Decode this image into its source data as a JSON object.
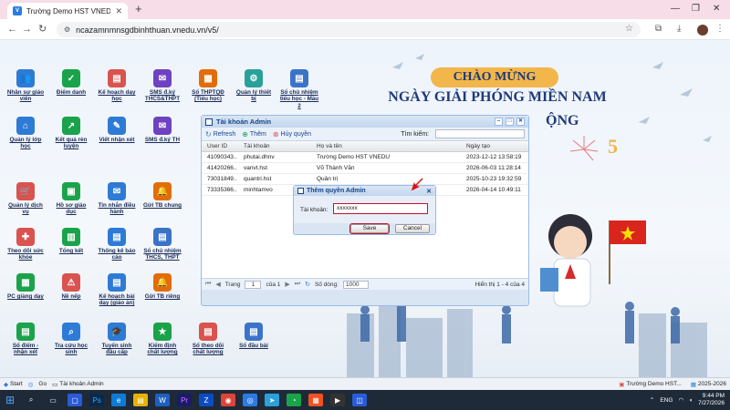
{
  "browser": {
    "tab_title": "Trường Demo HST VNEDU - Là",
    "url": "ncazamnmnsgdbinhthuan.vnedu.vn/v5/"
  },
  "desktop_icons": [
    {
      "label": "Nhân sự giáo viên",
      "color": "#2e7bd6",
      "glyph": "👥"
    },
    {
      "label": "Điểm danh",
      "color": "#1aa34a",
      "glyph": "✓"
    },
    {
      "label": "Kế hoạch dạy học",
      "color": "#d9534f",
      "glyph": "▤"
    },
    {
      "label": "SMS đ.ký THCS&THPT",
      "color": "#6f42c1",
      "glyph": "✉"
    },
    {
      "label": "Sổ THPTQĐ (Tiểu học)",
      "color": "#e36c0a",
      "glyph": "▦"
    },
    {
      "label": "Quản lý thiết bị",
      "color": "#2aa198",
      "glyph": "⚙"
    },
    {
      "label": "Sổ chủ nhiệm tiểu học - Mẫu 2",
      "color": "#3b73c8",
      "glyph": "▤"
    },
    {
      "label": "Quản lý lớp học",
      "color": "#2e7bd6",
      "glyph": "⌂"
    },
    {
      "label": "Kết quả rèn luyện",
      "color": "#1aa34a",
      "glyph": "↗"
    },
    {
      "label": "Viết nhận xét",
      "color": "#2e7bd6",
      "glyph": "✎"
    },
    {
      "label": "SMS đ.ký TH",
      "color": "#6f42c1",
      "glyph": "✉"
    },
    {
      "label": "Quản lý dịch vụ",
      "color": "#d9534f",
      "glyph": "🛒"
    },
    {
      "label": "Hồ sơ giáo dục",
      "color": "#1aa34a",
      "glyph": "▣"
    },
    {
      "label": "Tin nhắn điều hành",
      "color": "#2e7bd6",
      "glyph": "✉"
    },
    {
      "label": "Gửi TB chung",
      "color": "#e36c0a",
      "glyph": "🔔"
    },
    {
      "label": "Theo dõi sức khỏe",
      "color": "#d9534f",
      "glyph": "✚"
    },
    {
      "label": "Tổng kết",
      "color": "#1aa34a",
      "glyph": "▥"
    },
    {
      "label": "Thống kê báo cáo",
      "color": "#2e7bd6",
      "glyph": "▤"
    },
    {
      "label": "Sổ chủ nhiệm THCS, THPT",
      "color": "#3b73c8",
      "glyph": "▤"
    },
    {
      "label": "PC giảng dạy",
      "color": "#1aa34a",
      "glyph": "▦"
    },
    {
      "label": "Nề nếp",
      "color": "#d9534f",
      "glyph": "⚠"
    },
    {
      "label": "Kế hoạch bài dạy (giáo án)",
      "color": "#2e7bd6",
      "glyph": "▤"
    },
    {
      "label": "Gửi TB riêng",
      "color": "#e36c0a",
      "glyph": "🔔"
    },
    {
      "label": "Sổ điểm - nhận xét",
      "color": "#1aa34a",
      "glyph": "▤"
    },
    {
      "label": "Tra cứu học sinh",
      "color": "#2e7bd6",
      "glyph": "⌕"
    },
    {
      "label": "Tuyển sinh đầu cấp",
      "color": "#2e7bd6",
      "glyph": "🎓"
    },
    {
      "label": "Kiểm định chất lượng",
      "color": "#1aa34a",
      "glyph": "★"
    },
    {
      "label": "Sổ theo dõi chất lượng",
      "color": "#d9534f",
      "glyph": "▤"
    },
    {
      "label": "Sổ đầu bài",
      "color": "#3b73c8",
      "glyph": "▤"
    }
  ],
  "banner": {
    "line1": "CHÀO MỪNG",
    "line2": "NGÀY GIẢI PHÓNG MIỀN NAM",
    "line3": "ỘNG",
    "line4": "5"
  },
  "admin_window": {
    "title": "Tài khoản Admin",
    "toolbar": {
      "refresh": "Refresh",
      "add": "Thêm",
      "revoke": "Hủy quyền",
      "search_label": "Tìm kiếm:"
    },
    "columns": [
      "User ID",
      "Tài khoản",
      "Họ và tên",
      "Ngày tạo"
    ],
    "rows": [
      [
        "41090343...",
        "phutai.dhnv",
        "Trường Demo HST VNEDU",
        "2023-12-12 13:58:19"
      ],
      [
        "41420266...",
        "vanvt.hst",
        "Võ Thành Văn",
        "2026-06-03 11:28:14"
      ],
      [
        "73031849...",
        "quantri.hst",
        "Quản trị",
        "2025-10-23 19:32:59"
      ],
      [
        "73335366...",
        "minhtamvo",
        "",
        "2026-04-14 10:49:11"
      ]
    ],
    "pager": {
      "page_label": "Trang",
      "page_value": "1",
      "of_label": "của 1",
      "page_size_label": "Số dòng:",
      "page_size": "1000",
      "info": "Hiển thị 1 - 4 của 4"
    }
  },
  "dialog": {
    "title": "Thêm quyền Admin",
    "field_label": "Tài khoản:",
    "field_value": "xxxxxxx",
    "save": "Save",
    "cancel": "Cancel"
  },
  "statusbar": {
    "start": "Start",
    "go": "Go",
    "window_item": "Tài khoản Admin",
    "school": "Trường Demo HST...",
    "year": "2025-2026"
  },
  "taskbar": {
    "lang": "ENG",
    "time": "9:44 PM",
    "date": "7/27/2026"
  }
}
